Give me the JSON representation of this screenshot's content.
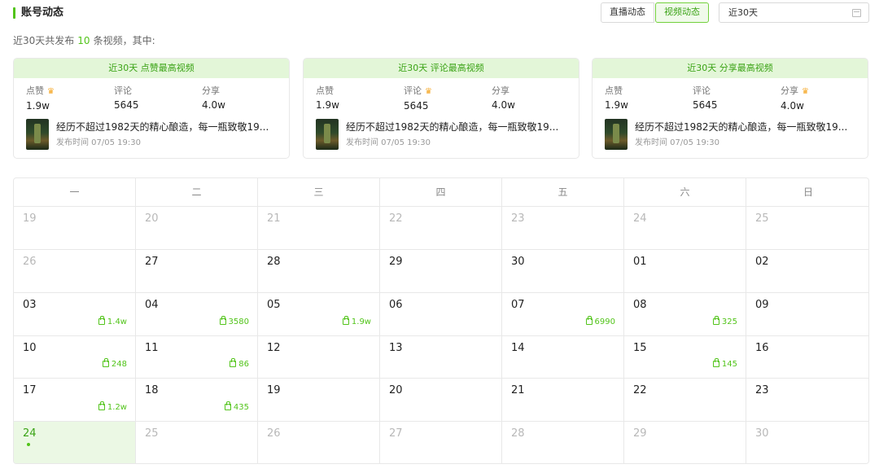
{
  "header": {
    "title": "账号动态",
    "tabs": [
      {
        "label": "直播动态",
        "active": false
      },
      {
        "label": "视频动态",
        "active": true
      }
    ],
    "date_range": "近30天"
  },
  "summary": {
    "prefix": "近30天共发布",
    "count": "10",
    "suffix": "条视频，其中:"
  },
  "cards": [
    {
      "heading": "近30天 点赞最高视频",
      "highlight": "likes",
      "likes_label": "点赞",
      "likes_value": "1.9w",
      "comments_label": "评论",
      "comments_value": "5645",
      "shares_label": "分享",
      "shares_value": "4.0w",
      "video_title": "经历不超过1982天的精心酿造，每一瓶致敬19...",
      "publish_time": "发布时间 07/05 19:30"
    },
    {
      "heading": "近30天 评论最高视频",
      "highlight": "comments",
      "likes_label": "点赞",
      "likes_value": "1.9w",
      "comments_label": "评论",
      "comments_value": "5645",
      "shares_label": "分享",
      "shares_value": "4.0w",
      "video_title": "经历不超过1982天的精心酿造，每一瓶致敬19...",
      "publish_time": "发布时间 07/05 19:30"
    },
    {
      "heading": "近30天 分享最高视频",
      "highlight": "shares",
      "likes_label": "点赞",
      "likes_value": "1.9w",
      "comments_label": "评论",
      "comments_value": "5645",
      "shares_label": "分享",
      "shares_value": "4.0w",
      "video_title": "经历不超过1982天的精心酿造，每一瓶致敬19...",
      "publish_time": "发布时间 07/05 19:30"
    }
  ],
  "calendar": {
    "weekdays": [
      "一",
      "二",
      "三",
      "四",
      "五",
      "六",
      "日"
    ],
    "weeks": [
      [
        {
          "day": "19",
          "muted": true
        },
        {
          "day": "20",
          "muted": true
        },
        {
          "day": "21",
          "muted": true
        },
        {
          "day": "22",
          "muted": true
        },
        {
          "day": "23",
          "muted": true
        },
        {
          "day": "24",
          "muted": true
        },
        {
          "day": "25",
          "muted": true
        }
      ],
      [
        {
          "day": "26",
          "muted": true
        },
        {
          "day": "27"
        },
        {
          "day": "28"
        },
        {
          "day": "29"
        },
        {
          "day": "30"
        },
        {
          "day": "01"
        },
        {
          "day": "02"
        }
      ],
      [
        {
          "day": "03",
          "likes": "1.4w"
        },
        {
          "day": "04",
          "likes": "3580"
        },
        {
          "day": "05",
          "likes": "1.9w"
        },
        {
          "day": "06"
        },
        {
          "day": "07",
          "likes": "6990"
        },
        {
          "day": "08",
          "likes": "325"
        },
        {
          "day": "09"
        }
      ],
      [
        {
          "day": "10",
          "likes": "248"
        },
        {
          "day": "11",
          "likes": "86"
        },
        {
          "day": "12"
        },
        {
          "day": "13"
        },
        {
          "day": "14"
        },
        {
          "day": "15",
          "likes": "145"
        },
        {
          "day": "16"
        }
      ],
      [
        {
          "day": "17",
          "likes": "1.2w"
        },
        {
          "day": "18",
          "likes": "435"
        },
        {
          "day": "19"
        },
        {
          "day": "20"
        },
        {
          "day": "21"
        },
        {
          "day": "22"
        },
        {
          "day": "23"
        }
      ],
      [
        {
          "day": "24",
          "today": true
        },
        {
          "day": "25",
          "muted": true
        },
        {
          "day": "26",
          "muted": true
        },
        {
          "day": "27",
          "muted": true
        },
        {
          "day": "28",
          "muted": true
        },
        {
          "day": "29",
          "muted": true
        },
        {
          "day": "30",
          "muted": true
        }
      ]
    ]
  },
  "colors": {
    "accent": "#52c41a",
    "accent_text": "#3aa315",
    "card_header_bg": "#e3f6d8",
    "today_bg": "#ebf8e4",
    "crown": "#f5a623"
  },
  "icons": {
    "crown": "crown-icon",
    "like": "thumbs-up-icon",
    "calendar": "calendar-icon"
  }
}
